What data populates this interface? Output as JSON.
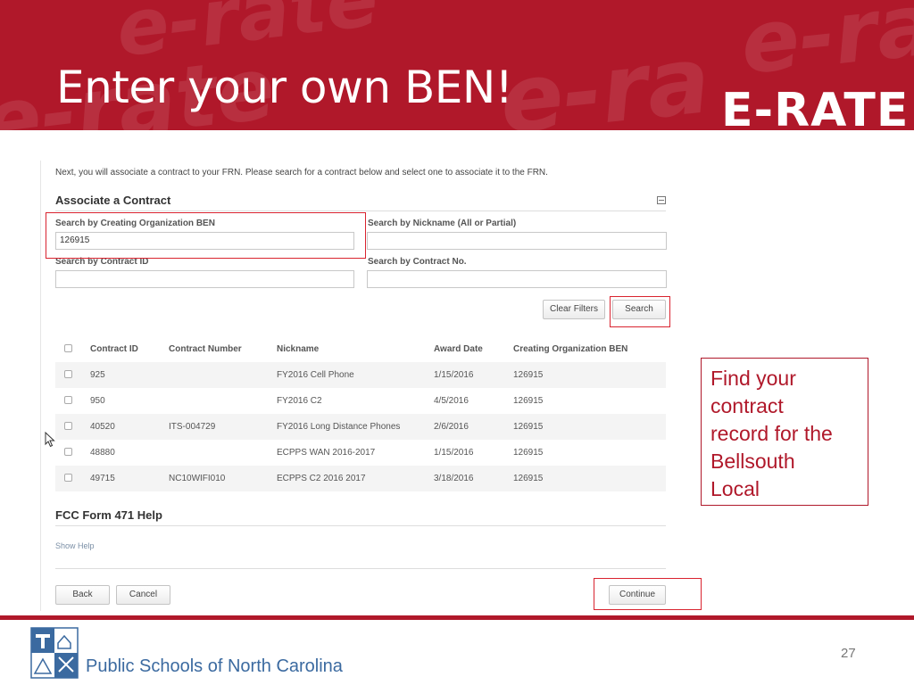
{
  "slide": {
    "title": "Enter your own BEN!",
    "logo_text": "E-RATE",
    "background_marks": [
      "e-rate",
      "e-rate",
      "e-ra"
    ]
  },
  "form": {
    "intro": "Next, you will associate a contract to your FRN. Please search for a contract below and select one to associate it to the FRN.",
    "title": "Associate a Contract",
    "fields": {
      "creating_org_ben": {
        "label": "Search by Creating Organization BEN",
        "value": "126915"
      },
      "nickname": {
        "label": "Search by Nickname (All or Partial)",
        "value": ""
      },
      "contract_id": {
        "label": "Search by Contract ID",
        "value": ""
      },
      "contract_no": {
        "label": "Search by Contract No.",
        "value": ""
      }
    },
    "buttons": {
      "clear": "Clear Filters",
      "search": "Search"
    },
    "table": {
      "headers": {
        "contract_id": "Contract ID",
        "contract_number": "Contract Number",
        "nickname": "Nickname",
        "award_date": "Award Date",
        "creating_org_ben": "Creating Organization BEN"
      },
      "rows": [
        {
          "contract_id": "925",
          "contract_number": "",
          "nickname": "FY2016 Cell Phone",
          "award_date": "1/15/2016",
          "creating_org_ben": "126915"
        },
        {
          "contract_id": "950",
          "contract_number": "",
          "nickname": "FY2016 C2",
          "award_date": "4/5/2016",
          "creating_org_ben": "126915"
        },
        {
          "contract_id": "40520",
          "contract_number": "ITS-004729",
          "nickname": "FY2016 Long Distance Phones",
          "award_date": "2/6/2016",
          "creating_org_ben": "126915"
        },
        {
          "contract_id": "48880",
          "contract_number": "",
          "nickname": "ECPPS WAN 2016-2017",
          "award_date": "1/15/2016",
          "creating_org_ben": "126915"
        },
        {
          "contract_id": "49715",
          "contract_number": "NC10WIFI010",
          "nickname": "ECPPS C2 2016 2017",
          "award_date": "3/18/2016",
          "creating_org_ben": "126915"
        }
      ]
    },
    "help": {
      "title": "FCC Form 471 Help",
      "link": "Show Help"
    },
    "nav": {
      "back": "Back",
      "cancel": "Cancel",
      "continue": "Continue"
    }
  },
  "callout": {
    "line1": "Find your",
    "line2": "contract",
    "line3": "record for the",
    "line4": "Bellsouth",
    "line5": "Local"
  },
  "footer": {
    "org": "Public Schools of North Carolina",
    "page_number": "27"
  },
  "colors": {
    "brand_red": "#b0182a",
    "highlight_red": "#d9232f",
    "footer_blue": "#3b6aa0"
  }
}
